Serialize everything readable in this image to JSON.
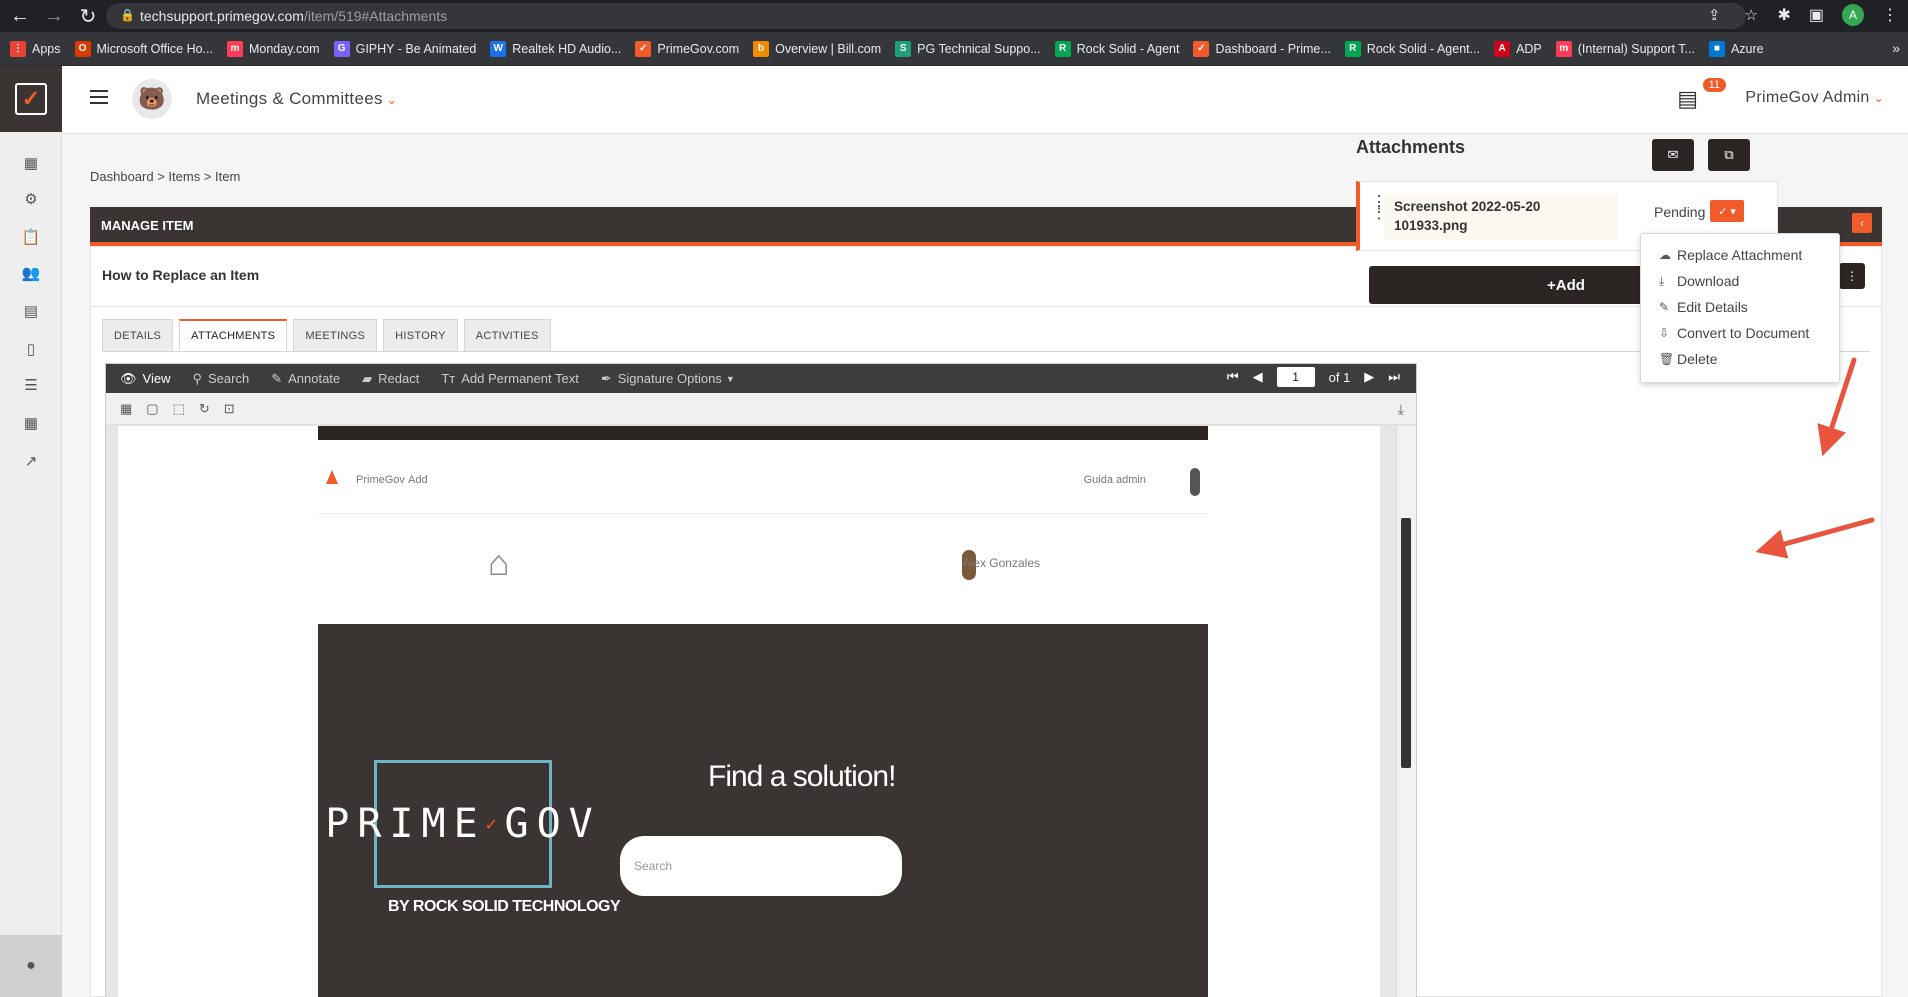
{
  "browser": {
    "url_host": "techsupport.primegov.com",
    "url_path": "/item/519#Attachments",
    "profile_initial": "A",
    "bookmarks": [
      {
        "label": "Apps",
        "color": "#ea4335",
        "glyph": "⋮"
      },
      {
        "label": "Microsoft Office Ho...",
        "color": "#d83b01",
        "glyph": "O"
      },
      {
        "label": "Monday.com",
        "color": "#ff3d57",
        "glyph": "m"
      },
      {
        "label": "GIPHY - Be Animated",
        "color": "#7b61ff",
        "glyph": "G"
      },
      {
        "label": "Realtek HD Audio...",
        "color": "#1a73e8",
        "glyph": "W"
      },
      {
        "label": "PrimeGov.com",
        "color": "#f15a29",
        "glyph": "✓"
      },
      {
        "label": "Overview | Bill.com",
        "color": "#f38b00",
        "glyph": "b"
      },
      {
        "label": "PG Technical Suppo...",
        "color": "#1f9e77",
        "glyph": "S"
      },
      {
        "label": "Rock Solid - Agent",
        "color": "#00a651",
        "glyph": "R"
      },
      {
        "label": "Dashboard - Prime...",
        "color": "#f15a29",
        "glyph": "✓"
      },
      {
        "label": "Rock Solid - Agent...",
        "color": "#00a651",
        "glyph": "R"
      },
      {
        "label": "ADP",
        "color": "#d0021b",
        "glyph": "A"
      },
      {
        "label": "(Internal) Support T...",
        "color": "#ff3d57",
        "glyph": "m"
      },
      {
        "label": "Azure",
        "color": "#0078d4",
        "glyph": "■"
      }
    ]
  },
  "header": {
    "module": "Meetings & Committees",
    "badge_count": "11",
    "user": "PrimeGov Admin"
  },
  "breadcrumb": "Dashboard > Items > Item",
  "panel": {
    "title": "MANAGE ITEM",
    "item_title": "How to Replace an Item",
    "tabs": [
      "DETAILS",
      "ATTACHMENTS",
      "MEETINGS",
      "HISTORY",
      "ACTIVITIES"
    ],
    "active_tab": "ATTACHMENTS"
  },
  "viewer": {
    "tools": [
      "View",
      "Search",
      "Annotate",
      "Redact",
      "Add Permanent Text",
      "Signature Options"
    ],
    "page_current": "1",
    "page_total": "of 1",
    "doc": {
      "nav_item_1": "PrimeGov",
      "nav_item_2": "Add",
      "nav_user": "Guida admin",
      "user_name": "Alex Gonzales",
      "logo_text_left": "PRIME",
      "logo_text_right": "GOV",
      "logo_sub": "BY ROCK SOLID TECHNOLOGY",
      "hero_title": "Find a solution!",
      "hero_search": "Search"
    }
  },
  "attachments": {
    "title": "Attachments",
    "file_name": "Screenshot 2022-05-20 101933.png",
    "status": "Pending",
    "add_label": "+Add",
    "menu": [
      {
        "label": "Replace Attachment",
        "icon": "cloud-upload-icon"
      },
      {
        "label": "Download",
        "icon": "download-icon"
      },
      {
        "label": "Edit Details",
        "icon": "pencil-icon"
      },
      {
        "label": "Convert to Document",
        "icon": "convert-icon"
      },
      {
        "label": "Delete",
        "icon": "trash-icon"
      }
    ]
  },
  "colors": {
    "accent": "#f15a29",
    "dark": "#3a3532",
    "annotation_arrow": "#e8543d"
  }
}
